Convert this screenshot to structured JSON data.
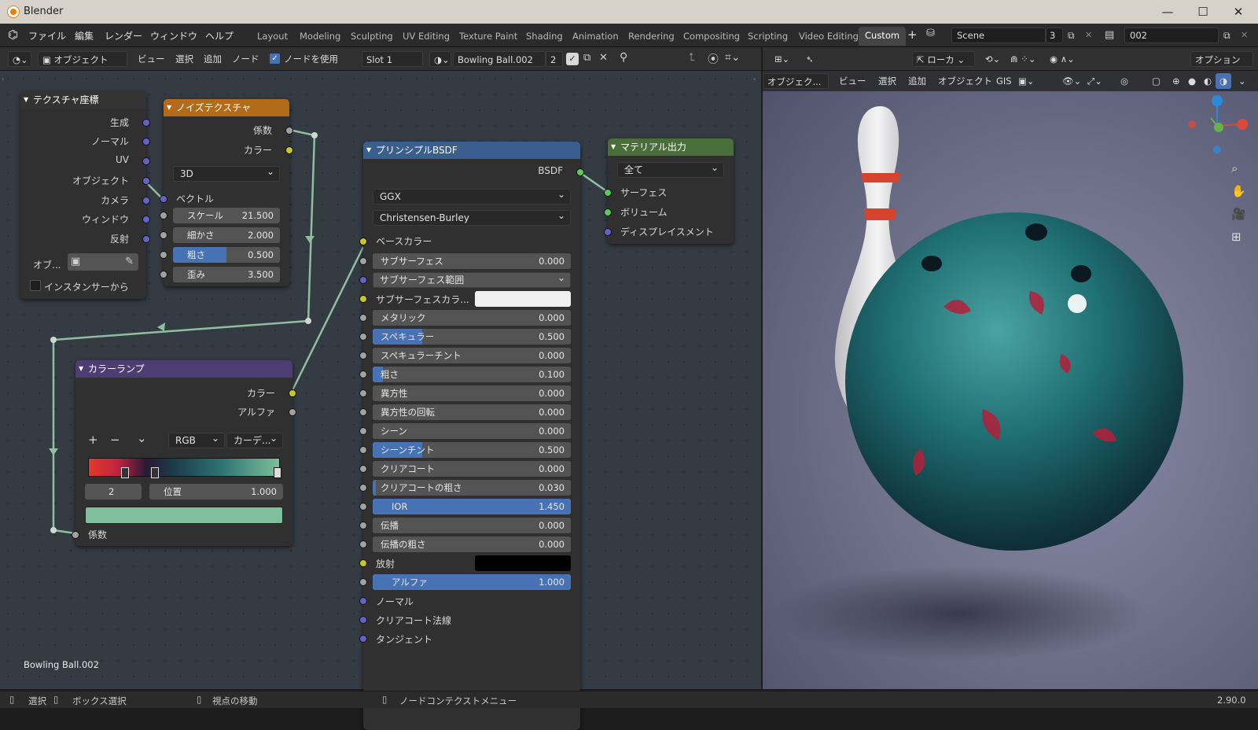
{
  "app": {
    "title": "Blender",
    "version": "2.90.0"
  },
  "menu": [
    "ファイル",
    "編集",
    "レンダー",
    "ウィンドウ",
    "ヘルプ"
  ],
  "workspaces": [
    "Layout",
    "Modeling",
    "Sculpting",
    "UV Editing",
    "Texture Paint",
    "Shading",
    "Animation",
    "Rendering",
    "Compositing",
    "Scripting",
    "Video Editing",
    "Custom"
  ],
  "active_workspace": "Custom",
  "scene": {
    "name": "Scene",
    "count": "3"
  },
  "view_layer": "002",
  "node_header": {
    "mode": "オブジェクト",
    "menus": [
      "ビュー",
      "選択",
      "追加",
      "ノード"
    ],
    "use_nodes": "ノードを使用",
    "slot": "Slot 1",
    "material": "Bowling Ball.002",
    "users": "2"
  },
  "viewport_header": {
    "transform": "ローカ",
    "options": "オプション",
    "menus": [
      "オブジェク...",
      "ビュー",
      "選択",
      "追加",
      "オブジェクト",
      "GIS"
    ]
  },
  "nodes": {
    "texcoord": {
      "title": "テクスチャ座標",
      "outputs": [
        "生成",
        "ノーマル",
        "UV",
        "オブジェクト",
        "カメラ",
        "ウィンドウ",
        "反射"
      ],
      "object_label": "オブ...",
      "instancer": "インスタンサーから"
    },
    "noise": {
      "title": "ノイズテクスチャ",
      "outputs": [
        "係数",
        "カラー"
      ],
      "dim": "3D",
      "vector": "ベクトル",
      "params": [
        {
          "label": "スケール",
          "value": "21.500",
          "fill": 0
        },
        {
          "label": "細かさ",
          "value": "2.000",
          "fill": 0
        },
        {
          "label": "粗さ",
          "value": "0.500",
          "fill": 0.5
        },
        {
          "label": "歪み",
          "value": "3.500",
          "fill": 0
        }
      ]
    },
    "ramp": {
      "title": "カラーランプ",
      "outputs": [
        "カラー",
        "アルファ"
      ],
      "mode": "RGB",
      "interp": "カーデ...",
      "index": "2",
      "pos_label": "位置",
      "pos_value": "1.000",
      "input": "係数",
      "add": "+",
      "remove": "−",
      "menu": "⌄"
    },
    "bsdf": {
      "title": "プリンシプルBSDF",
      "output": "BSDF",
      "dist": "GGX",
      "sss_method": "Christensen-Burley",
      "base_color": "ベースカラー",
      "sss_radius": "サブサーフェス範囲",
      "sss_color": "サブサーフェスカラ...",
      "emission": "放射",
      "params": [
        {
          "label": "サブサーフェス",
          "value": "0.000",
          "fill": 0
        },
        {
          "label": "メタリック",
          "value": "0.000",
          "fill": 0
        },
        {
          "label": "スペキュラー",
          "value": "0.500",
          "fill": 0.5
        },
        {
          "label": "スペキュラーチント",
          "value": "0.000",
          "fill": 0
        },
        {
          "label": "粗さ",
          "value": "0.100",
          "fill": 0.1
        },
        {
          "label": "異方性",
          "value": "0.000",
          "fill": 0
        },
        {
          "label": "異方性の回転",
          "value": "0.000",
          "fill": 0
        },
        {
          "label": "シーン",
          "value": "0.000",
          "fill": 0
        },
        {
          "label": "シーンチント",
          "value": "0.500",
          "fill": 0.5
        },
        {
          "label": "クリアコート",
          "value": "0.000",
          "fill": 0
        },
        {
          "label": "クリアコートの粗さ",
          "value": "0.030",
          "fill": 0.03
        },
        {
          "label": "IOR",
          "value": "1.450",
          "fill": 1
        },
        {
          "label": "伝播",
          "value": "0.000",
          "fill": 0
        },
        {
          "label": "伝播の粗さ",
          "value": "0.000",
          "fill": 0
        }
      ],
      "alpha": {
        "label": "アルファ",
        "value": "1.000"
      },
      "vec_inputs": [
        "ノーマル",
        "クリアコート法線",
        "タンジェント"
      ]
    },
    "output": {
      "title": "マテリアル出力",
      "target": "全て",
      "inputs": [
        "サーフェス",
        "ボリューム",
        "ディスプレイスメント"
      ]
    }
  },
  "material_label": "Bowling Ball.002",
  "status": {
    "select": "選択",
    "box_select": "ボックス選択",
    "move_view": "視点の移動",
    "node_menu": "ノードコンテクストメニュー"
  },
  "colors": {
    "noise_header": "#b36b1a",
    "bsdf_header": "#3a5f8e",
    "ramp_header": "#4e3d73",
    "output_header": "#4a6e3a",
    "ball": "#1f6f73"
  }
}
